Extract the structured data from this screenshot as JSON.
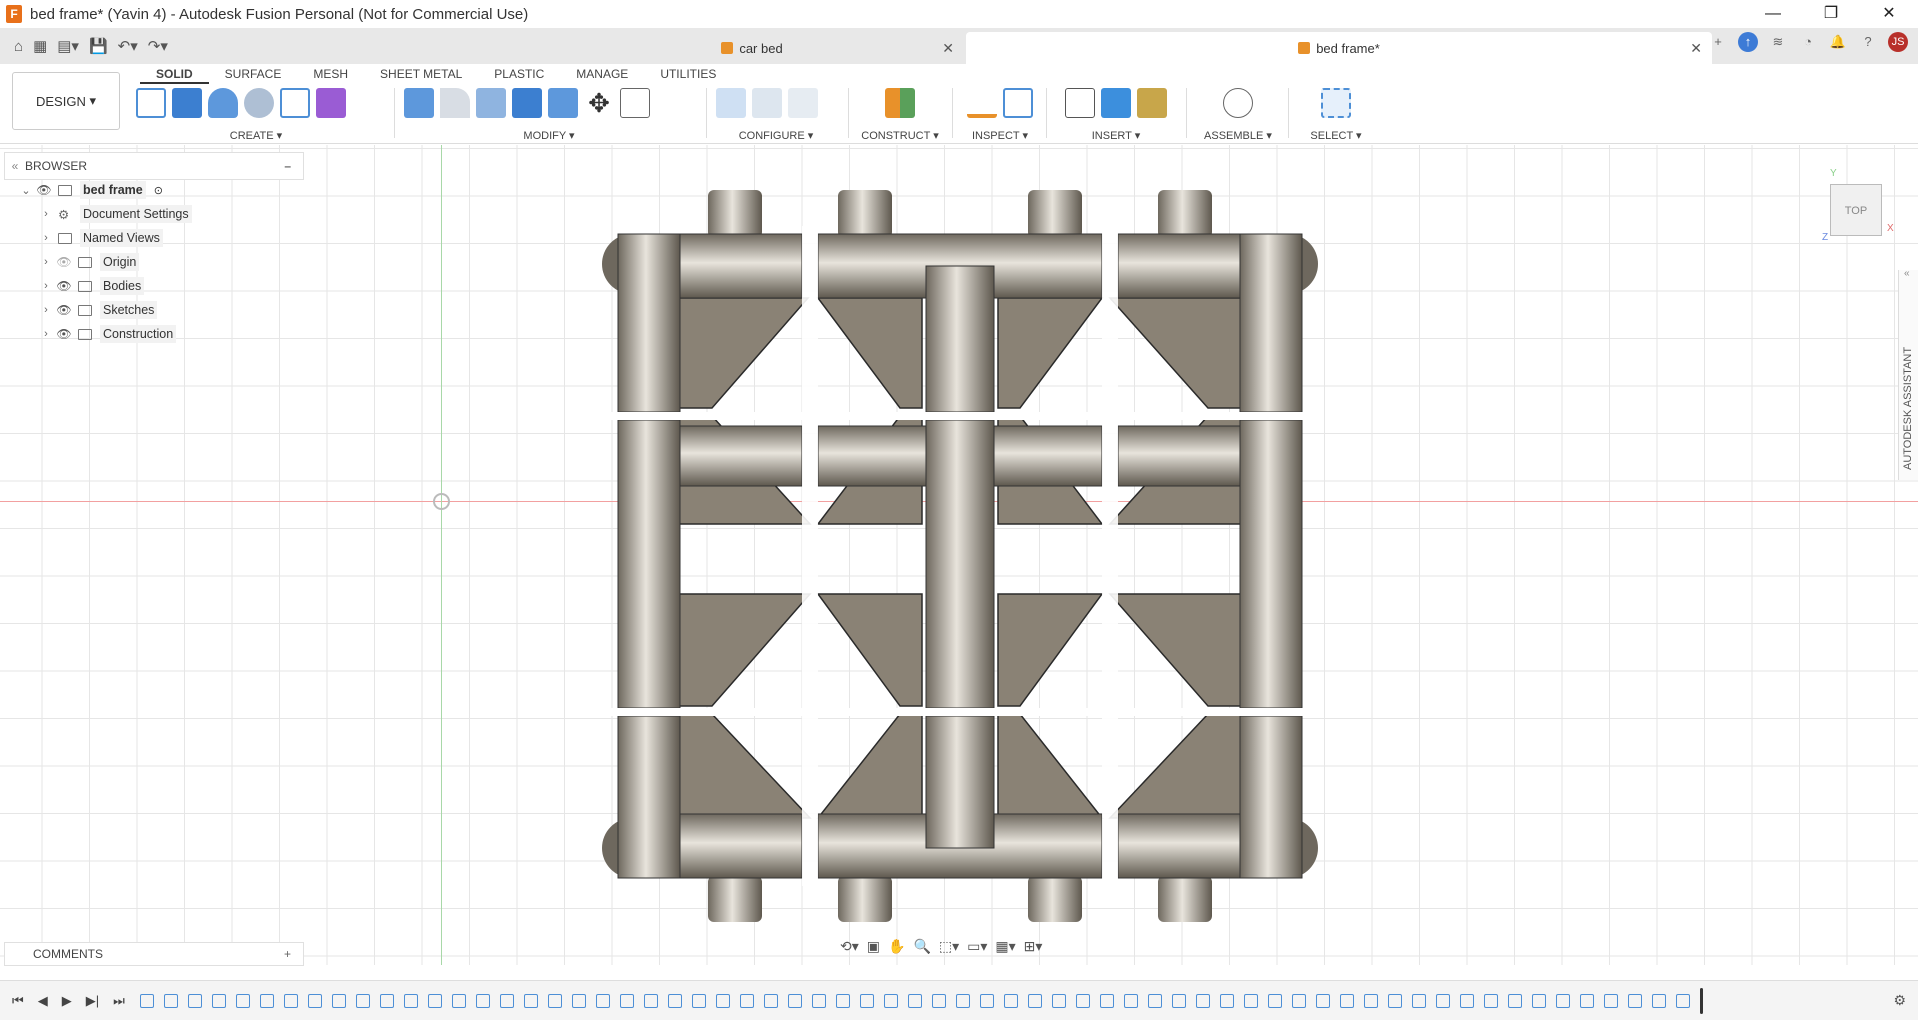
{
  "titlebar": {
    "title": "bed frame* (Yavin 4) - Autodesk Fusion Personal (Not for Commercial Use)",
    "app_icon": "F"
  },
  "tabs": [
    {
      "label": "car bed"
    },
    {
      "label": "bed frame*"
    }
  ],
  "user_initials": "JS",
  "design_button": "DESIGN",
  "ribbon_tabs": [
    "SOLID",
    "SURFACE",
    "MESH",
    "SHEET METAL",
    "PLASTIC",
    "MANAGE",
    "UTILITIES"
  ],
  "tool_groups": [
    "CREATE",
    "MODIFY",
    "CONFIGURE",
    "CONSTRUCT",
    "INSPECT",
    "INSERT",
    "ASSEMBLE",
    "SELECT"
  ],
  "browser": {
    "title": "BROWSER",
    "root": "bed frame",
    "items": [
      "Document Settings",
      "Named Views",
      "Origin",
      "Bodies",
      "Sketches",
      "Construction"
    ]
  },
  "comments_label": "COMMENTS",
  "viewcube": {
    "face": "TOP",
    "x": "X",
    "y": "Y",
    "z": "Z"
  },
  "assistant_label": "AUTODESK ASSISTANT",
  "colors": {
    "accent": "#e8701a",
    "model": "#8a8275",
    "axis_x": "#f2a0a0",
    "axis_y": "#a8d8a8"
  }
}
